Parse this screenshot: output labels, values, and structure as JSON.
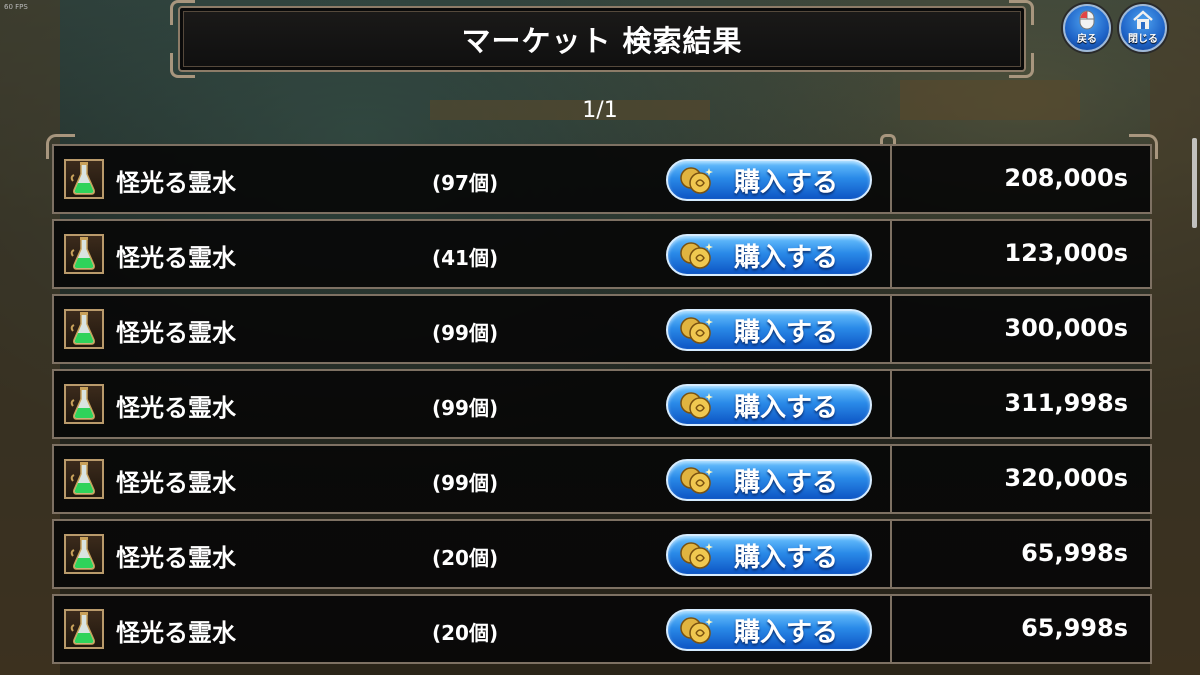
{
  "overlay": {
    "fps": "60 FPS"
  },
  "header": {
    "title": "マーケット 検索結果",
    "back_label": "戻る",
    "close_label": "閉じる"
  },
  "pagination": {
    "text": "1/1"
  },
  "listings": [
    {
      "item": "怪光る霊水",
      "qty": "(97個)",
      "buy": "購入する",
      "price": "208,000s"
    },
    {
      "item": "怪光る霊水",
      "qty": "(41個)",
      "buy": "購入する",
      "price": "123,000s"
    },
    {
      "item": "怪光る霊水",
      "qty": "(99個)",
      "buy": "購入する",
      "price": "300,000s"
    },
    {
      "item": "怪光る霊水",
      "qty": "(99個)",
      "buy": "購入する",
      "price": "311,998s"
    },
    {
      "item": "怪光る霊水",
      "qty": "(99個)",
      "buy": "購入する",
      "price": "320,000s"
    },
    {
      "item": "怪光る霊水",
      "qty": "(20個)",
      "buy": "購入する",
      "price": "65,998s"
    },
    {
      "item": "怪光る霊水",
      "qty": "(20個)",
      "buy": "購入する",
      "price": "65,998s"
    }
  ],
  "icons": {
    "back": "mouse-icon",
    "close": "house-icon",
    "item": "green-potion-flask-icon",
    "buy": "gold-coins-icon"
  },
  "colors": {
    "button_blue": "#2a8ae8",
    "frame_border": "#7e7163",
    "potion_green": "#2fd35a",
    "coin_gold": "#e0b440"
  }
}
